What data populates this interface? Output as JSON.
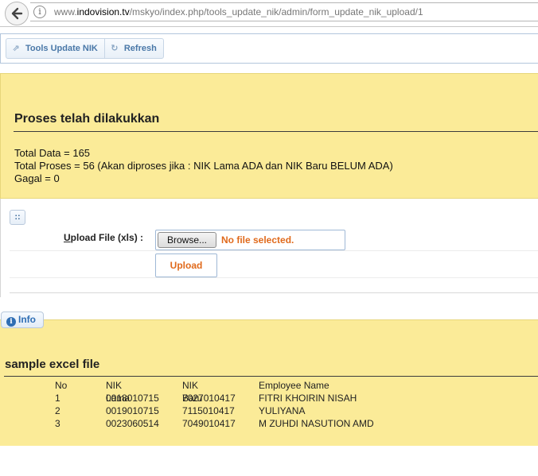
{
  "browser": {
    "url_prefix": "www.",
    "url_domain": "indovision.tv",
    "url_path": "/mskyo/index.php/tools_update_nik/admin/form_update_nik_upload/1"
  },
  "toolbar": {
    "tools_label": "Tools Update NIK",
    "refresh_label": "Refresh"
  },
  "result": {
    "title": "Proses telah dilakukkan",
    "lines": [
      "Total Data = 165",
      "Total Proses = 56 (Akan diproses jika : NIK Lama ADA dan NIK Baru BELUM ADA)",
      "Gagal = 0"
    ]
  },
  "upload": {
    "handle": "::",
    "label_first_letter": "U",
    "label_rest": "pload File (xls) :",
    "browse_label": "Browse...",
    "file_status": "No file selected.",
    "upload_label": "Upload"
  },
  "info": {
    "tab_icon": "i",
    "tab_label": "Info",
    "title": "sample excel file",
    "table": {
      "headers": [
        "No",
        "NIK Lama",
        "NIK Baru",
        "Employee Name"
      ],
      "rows": [
        [
          "1",
          "0018010715",
          "7027010417",
          "FITRI KHOIRIN NISAH"
        ],
        [
          "2",
          "0019010715",
          "7115010417",
          "YULIYANA"
        ],
        [
          "3",
          "0023060514",
          "7049010417",
          "M ZUHDI NASUTION AMD"
        ]
      ]
    }
  },
  "colors": {
    "panel_yellow": "#fbeb98",
    "accent_orange": "#e06a1c",
    "link_blue": "#4a78a8"
  },
  "icons": {
    "back": "back-arrow-icon",
    "site_info": "site-info-icon",
    "tools": "external-link-icon",
    "refresh": "refresh-icon",
    "info": "info-icon"
  }
}
